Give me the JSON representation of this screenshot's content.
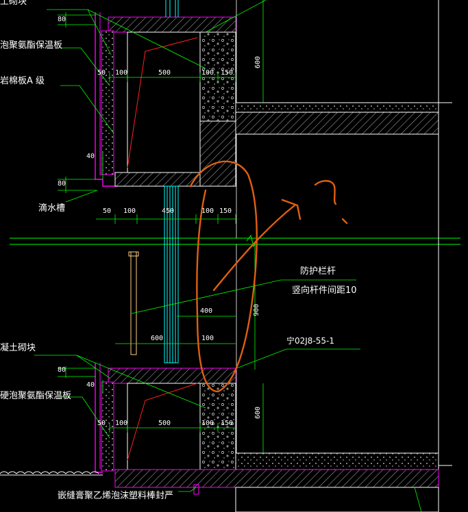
{
  "drawing": {
    "annotations": {
      "block_top": "土砌块",
      "insulation_top": "泡聚氨酯保温板",
      "rockwool": "岩棉板A 级",
      "drip_groove": "滴水槽",
      "railing": "防护栏杆",
      "railing_spacing": "竖向杆件间距10",
      "std_ref": "宁02J8-55-1",
      "block_bottom": "凝土砌块",
      "insulation_bottom": "硬泡聚氨酯保温板",
      "sealant": "嵌缝膏聚乙烯泡沫塑料棒封严"
    },
    "dimensions": {
      "d80_a": "80",
      "d50_a": "50",
      "d100_a": "100",
      "d500_a": "500",
      "d100_b": "100",
      "d150_a": "150",
      "d600_v_top": "600",
      "d40_a": "40",
      "d80_b": "80",
      "d50_b": "50",
      "d100_c": "100",
      "d450": "450",
      "d100_d": "100",
      "d150_b": "150",
      "d900_v": "900",
      "d400": "400",
      "d600_h": "600",
      "d100_e": "100",
      "d80_c": "80",
      "d40_b": "40",
      "d50_c": "50",
      "d100_f": "100",
      "d500_b": "500",
      "d100_g": "100",
      "d150_c": "150",
      "d600_v_bottom": "600"
    },
    "colors": {
      "background": "#000000",
      "wall_outline": "#ff00ff",
      "leader_lines": "#00ff00",
      "dimension_lines": "#00ff00",
      "window_frame": "#00ffff",
      "cut_line": "#ff0000",
      "markup": "#e06010",
      "text": "#ffffff"
    }
  }
}
